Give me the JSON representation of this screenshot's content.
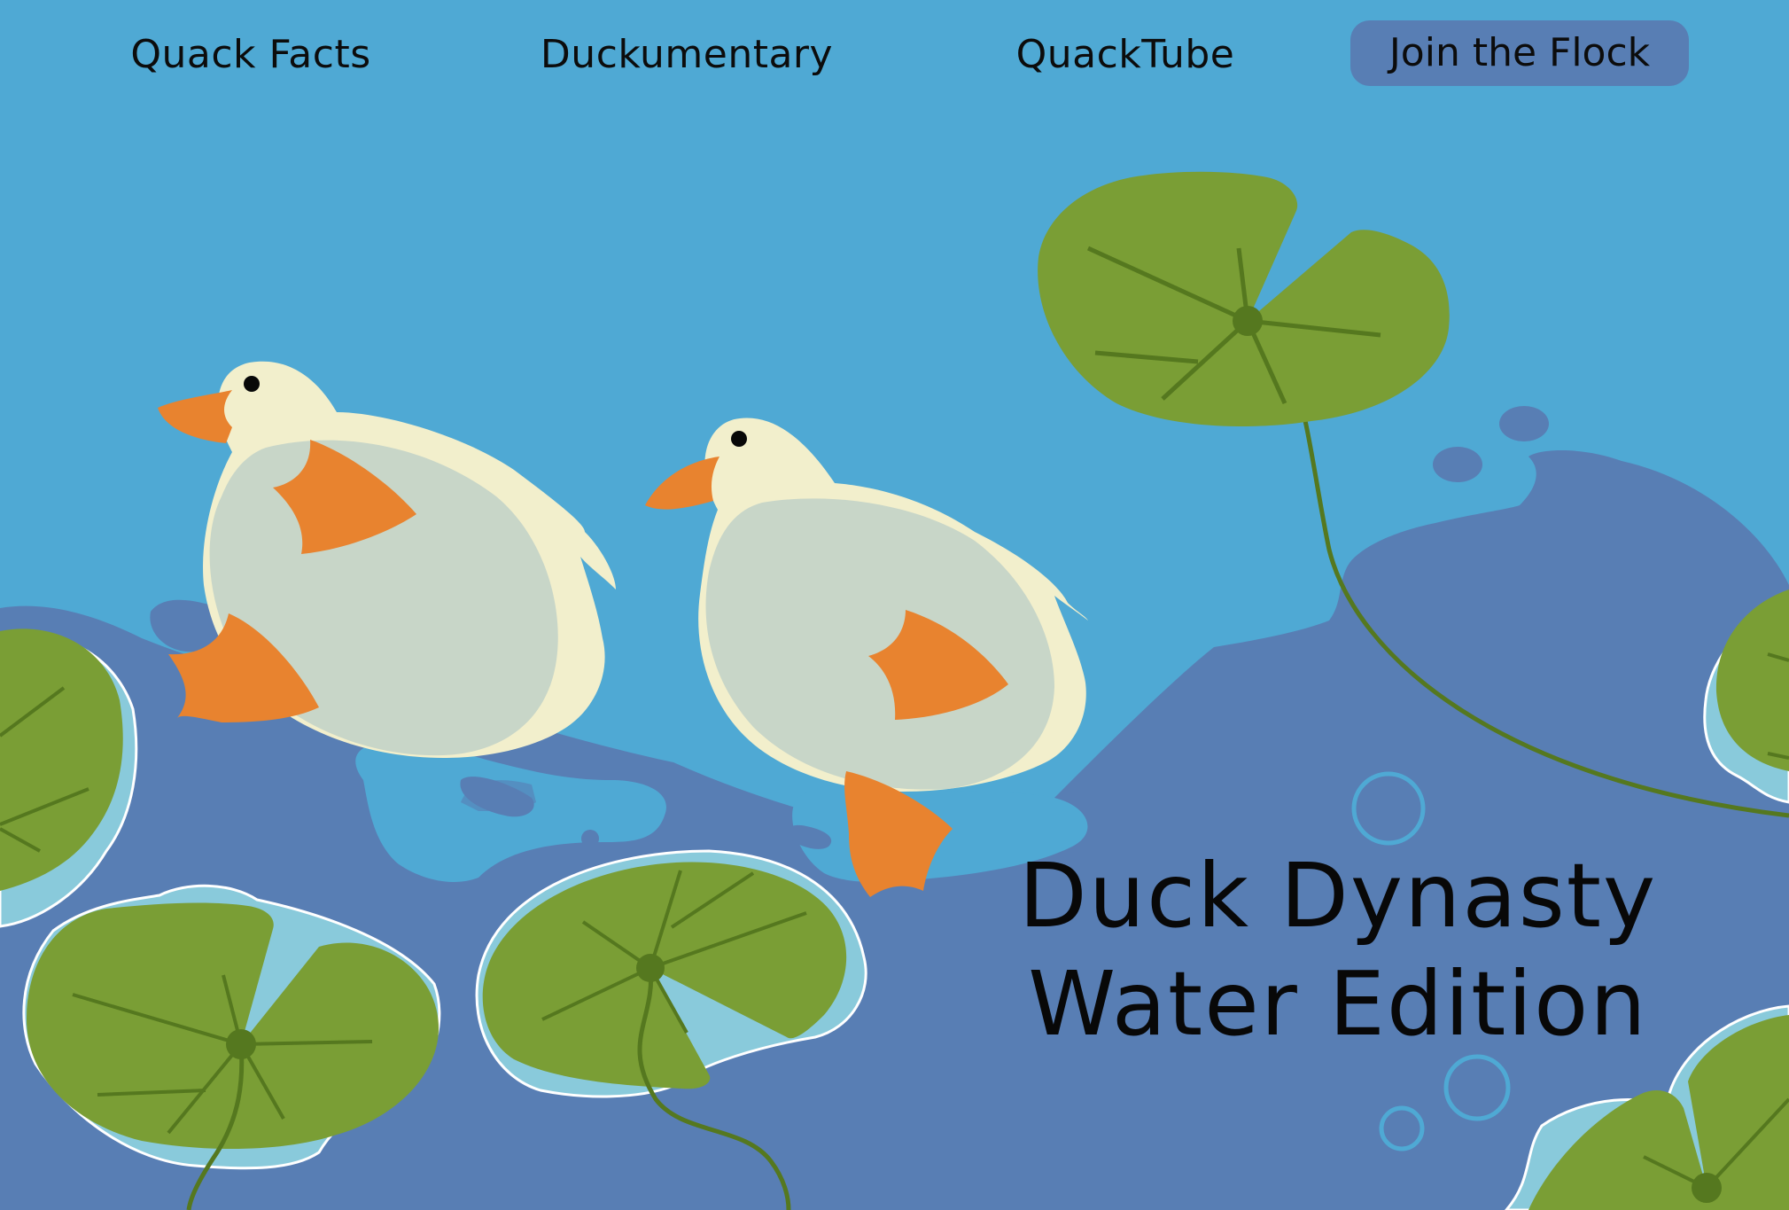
{
  "nav": {
    "links": [
      {
        "label": "Quack Facts"
      },
      {
        "label": "Duckumentary"
      },
      {
        "label": "QuackTube"
      }
    ],
    "cta_label": "Join the Flock"
  },
  "hero": {
    "title_line1": "Duck Dynasty",
    "title_line2": "Water Edition"
  },
  "colors": {
    "sky_water": "#4fa9d4",
    "deep_water": "#587eb4",
    "lily_pad": "#7a9e35",
    "lily_vein": "#55781f",
    "duck_body": "#c8d6c8",
    "duck_cream": "#f2efcc",
    "duck_orange": "#e8832f",
    "ripple_light": "#89cadb"
  },
  "illustration": {
    "ducks": [
      "duck",
      "duck"
    ],
    "lily_pads": [
      "lily-pad",
      "lily-pad",
      "lily-pad",
      "lily-pad",
      "lily-pad",
      "lily-pad"
    ]
  }
}
